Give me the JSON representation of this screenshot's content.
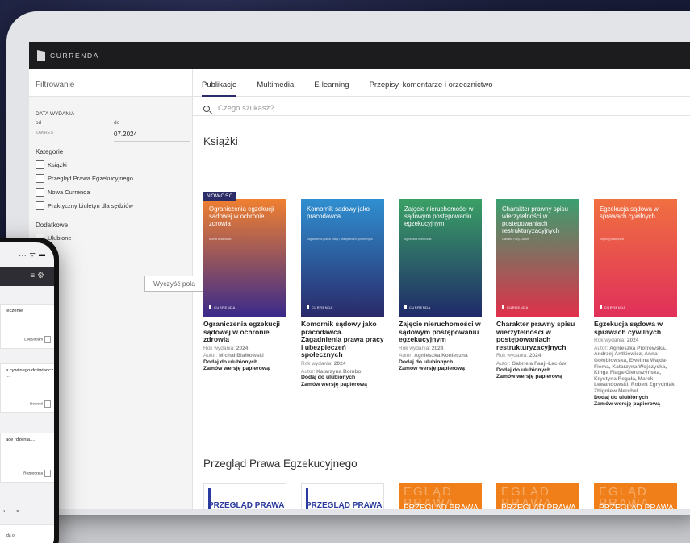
{
  "brand": {
    "name": "CURRENDA"
  },
  "filter": {
    "title": "Filtrowanie",
    "date_label": "DATA WYDANIA",
    "from_label": "od",
    "to_label": "do",
    "from_value": "ZAKRES",
    "to_value": "07.2024",
    "categories_label": "Kategorie",
    "categories": [
      "Książki",
      "Przegląd Prawa Egzekucyjnego",
      "Nowa Currenda",
      "Praktyczny biuletyn dla sędziów"
    ],
    "extra_label": "Dodatkowe",
    "extra": [
      "Ulubione"
    ],
    "clear_button": "Wyczyść pola"
  },
  "tabs": [
    "Publikacje",
    "Multimedia",
    "E-learning",
    "Przepisy, komentarze i orzecznictwo"
  ],
  "search": {
    "placeholder": "Czego szukasz?"
  },
  "books_section": {
    "title": "Książki",
    "badge": "NOWOŚĆ",
    "year_label": "Rok wydania:",
    "author_label": "Autor:",
    "fav_action": "Dodaj do ulubionych",
    "order_action": "Zamów wersję papierową",
    "items": [
      {
        "cover_title": "Ograniczenia egzekucji sądowej w ochronie zdrowia",
        "cover_sub": "Michał Białkowski",
        "title": "Ograniczenia egzekucji sądowej w ochronie zdrowia",
        "year": "2024",
        "author": "Michał Białkowski",
        "color_top": "#f08030",
        "color_bottom": "#3a2a8a"
      },
      {
        "cover_title": "Komornik sądowy jako pracodawca",
        "cover_sub": "Zagadnienia prawa pracy i ubezpieczeń społecznych",
        "title": "Komornik sądowy jako pracodawca. Zagadnienia prawa pracy i ubezpieczeń społecznych",
        "year": "2024",
        "author": "Katarzyna Bombo",
        "color_top": "#2f8fd0",
        "color_bottom": "#2a2a6a"
      },
      {
        "cover_title": "Zajęcie nieruchomości w sądowym postępowaniu egzekucyjnym",
        "cover_sub": "Agnieszka Konieczna",
        "title": "Zajęcie nieruchomości w sądowym postępowaniu egzekucyjnym",
        "year": "2024",
        "author": "Agnieszka Konieczna",
        "color_top": "#3aa065",
        "color_bottom": "#1f2a6a"
      },
      {
        "cover_title": "Charakter prawny spisu wierzytelności w postępowaniach restrukturyzacyjnych",
        "cover_sub": "Gabriela Fanji-Łaciów",
        "title": "Charakter prawny spisu wierzytelności w postępowaniach restrukturyzacyjnych",
        "year": "2024",
        "author": "Gabriela Fanji-Łaciów",
        "color_top": "#3aa070",
        "color_bottom": "#e0304a"
      },
      {
        "cover_title": "Egzekucja sądowa w sprawach cywilnych",
        "cover_sub": "Aspekty praktyczne",
        "title": "Egzekucja sądowa w sprawach cywilnych",
        "year": "2024",
        "author": "Agnieszka Piotrowska, Andrzej Antkiewicz, Anna Gołębiowska, Ewelina Wajda-Fiema, Katarzyna Wojczycka, Kinga Flaga-Gieruszyńska, Krystyna Regała, Marek Lewandowski, Robert Zgrydniak, Zbigniew Merchel",
        "color_top": "#f07040",
        "color_bottom": "#e0305a"
      }
    ]
  },
  "journal_section": {
    "title": "Przegląd Prawa Egzekucyjnego",
    "items": [
      {
        "style": "white",
        "text": "PRZEGLĄD PRAWA EGZEKUCYJNEGO"
      },
      {
        "style": "white",
        "text": "PRZEGLĄD PRAWA EGZEKUCYJNEGO"
      },
      {
        "style": "orange",
        "text": "PRZEGLĄD PRAWA EGZEKUCYJNEGO",
        "bg_text": "EGLĄD PRAWA"
      },
      {
        "style": "orange",
        "text": "PRZEGLĄD PRAWA EGZEKUCYJNEGO",
        "bg_text": "EGLĄD PRAWA"
      },
      {
        "style": "orange",
        "text": "PRZEGLĄD PRAWA EGZEKUCYJNEGO",
        "bg_text": "EGLĄD PRAWA"
      }
    ]
  },
  "phone": {
    "status": "... ᯤ ▬",
    "cards": [
      {
        "text": "ieczenie",
        "chip": "LiveStream"
      },
      {
        "text": "a cywilnego doświadcz ...",
        "chip": "Nowość"
      },
      {
        "text": "ące rdzenia....",
        "chip": "Rozpoczęta"
      }
    ],
    "pager": "› »",
    "bottom": "da ol"
  },
  "colors": {
    "app_bar": "#1c1c1e",
    "badge": "#2c2c66",
    "journal_orange": "#f07f1a",
    "journal_blue": "#2b3a9e"
  }
}
